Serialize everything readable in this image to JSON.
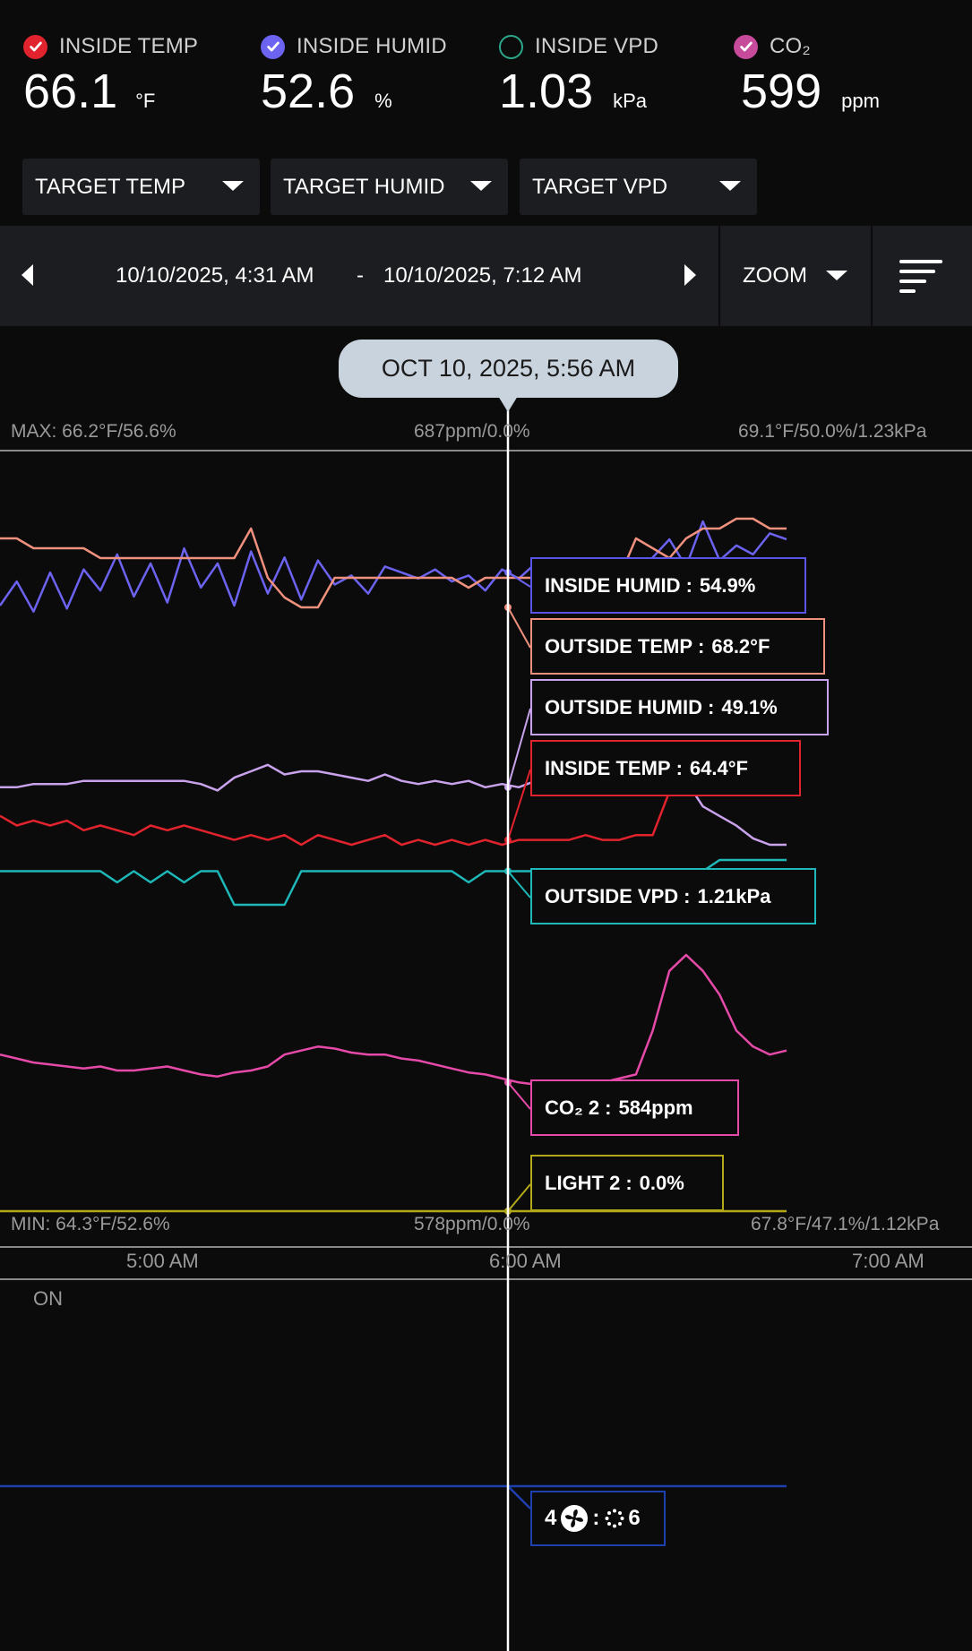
{
  "stats": [
    {
      "label": "INSIDE TEMP",
      "value": "66.1",
      "unit": "°F",
      "color": "#e0232d",
      "checked": true
    },
    {
      "label": "INSIDE HUMID",
      "value": "52.6",
      "unit": "%",
      "color": "#6c63f0",
      "checked": true
    },
    {
      "label": "INSIDE VPD",
      "value": "1.03",
      "unit": "kPa",
      "color": "#2ba88a",
      "checked": false
    },
    {
      "label": "CO₂",
      "value": "599",
      "unit": "ppm",
      "color": "#c74a9b",
      "checked": true
    }
  ],
  "targets": [
    "TARGET TEMP",
    "TARGET HUMID",
    "TARGET VPD"
  ],
  "range": {
    "start": "10/10/2025, 4:31 AM",
    "dash": "-",
    "end": "10/10/2025, 7:12 AM",
    "zoom": "ZOOM"
  },
  "cursor": {
    "label": "OCT 10, 2025, 5:56 AM"
  },
  "scale": {
    "max_left": "MAX: 66.2°F/56.6%",
    "max_center": "687ppm/0.0%",
    "max_right": "69.1°F/50.0%/1.23kPa",
    "min_left": "MIN: 64.3°F/52.6%",
    "min_center": "578ppm/0.0%",
    "min_right": "67.8°F/47.1%/1.12kPa"
  },
  "time_axis": [
    "5:00 AM",
    "6:00 AM",
    "7:00 AM"
  ],
  "device_lane": {
    "on_label": "ON",
    "tooltip_left": "4",
    "tooltip_sep": ":",
    "tooltip_right": "6"
  },
  "tooltips": [
    {
      "name": "INSIDE HUMID",
      "value": "54.9%",
      "color": "#5a55e6"
    },
    {
      "name": "OUTSIDE TEMP",
      "value": "68.2°F",
      "color": "#f0917e"
    },
    {
      "name": "OUTSIDE HUMID",
      "value": "49.1%",
      "color": "#c9a2ec"
    },
    {
      "name": "INSIDE TEMP",
      "value": "64.4°F",
      "color": "#e0232d"
    },
    {
      "name": "OUTSIDE VPD",
      "value": "1.21kPa",
      "color": "#1fb8b8"
    },
    {
      "name": "CO₂ 2",
      "value": "584ppm",
      "color": "#e64aa8"
    },
    {
      "name": "LIGHT 2",
      "value": "0.0%",
      "color": "#b3a81a"
    }
  ],
  "chart_data": {
    "type": "line",
    "x_range": [
      "4:31 AM",
      "7:12 AM"
    ],
    "x_ticks": [
      "5:00 AM",
      "6:00 AM",
      "7:00 AM"
    ],
    "cursor_time": "5:56 AM",
    "series": [
      {
        "name": "INSIDE HUMID",
        "color": "#6c63f0",
        "cursor_value": 54.9,
        "unit": "%",
        "y": [
          53.8,
          54.6,
          53.6,
          54.9,
          53.7,
          55.0,
          54.3,
          55.5,
          54.1,
          55.2,
          53.9,
          55.7,
          54.4,
          55.2,
          53.8,
          55.6,
          54.2,
          55.4,
          54.0,
          55.3,
          54.5,
          54.8,
          54.2,
          55.1,
          54.9,
          54.7,
          55.0,
          54.6,
          54.8,
          54.3,
          55.0,
          54.7,
          55.2,
          54.9,
          54.6,
          55.1,
          54.9,
          55.2,
          54.9,
          55.4,
          56.0,
          55.1,
          56.6,
          55.3,
          55.8,
          55.5,
          56.2,
          56.0
        ]
      },
      {
        "name": "OUTSIDE TEMP",
        "color": "#f0917e",
        "cursor_value": 68.2,
        "unit": "°F",
        "y": [
          68.9,
          68.9,
          68.8,
          68.8,
          68.8,
          68.8,
          68.7,
          68.7,
          68.7,
          68.7,
          68.7,
          68.7,
          68.7,
          68.7,
          68.7,
          69.0,
          68.5,
          68.3,
          68.2,
          68.2,
          68.5,
          68.5,
          68.5,
          68.5,
          68.5,
          68.5,
          68.5,
          68.5,
          68.4,
          68.5,
          68.5,
          68.5,
          68.5,
          68.5,
          68.5,
          68.4,
          68.5,
          68.5,
          68.9,
          68.8,
          68.7,
          68.9,
          69.0,
          69.0,
          69.1,
          69.1,
          69.0,
          69.0
        ]
      },
      {
        "name": "OUTSIDE HUMID",
        "color": "#c9a2ec",
        "cursor_value": 49.1,
        "unit": "%",
        "y": [
          49.1,
          49.1,
          49.2,
          49.2,
          49.2,
          49.3,
          49.3,
          49.3,
          49.3,
          49.3,
          49.3,
          49.3,
          49.2,
          49.0,
          49.4,
          49.6,
          49.8,
          49.5,
          49.6,
          49.6,
          49.5,
          49.4,
          49.3,
          49.5,
          49.3,
          49.2,
          49.3,
          49.2,
          49.3,
          49.1,
          49.2,
          49.1,
          49.3,
          49.1,
          49.5,
          49.3,
          49.6,
          49.8,
          50.2,
          50.3,
          50.1,
          49.3,
          48.5,
          48.2,
          47.9,
          47.5,
          47.3,
          47.3
        ]
      },
      {
        "name": "INSIDE TEMP",
        "color": "#e0232d",
        "cursor_value": 64.4,
        "unit": "°F",
        "y": [
          64.9,
          64.7,
          64.8,
          64.7,
          64.8,
          64.6,
          64.7,
          64.6,
          64.5,
          64.7,
          64.6,
          64.7,
          64.6,
          64.5,
          64.4,
          64.5,
          64.4,
          64.5,
          64.3,
          64.5,
          64.4,
          64.3,
          64.4,
          64.5,
          64.3,
          64.4,
          64.3,
          64.4,
          64.3,
          64.4,
          64.3,
          64.4,
          64.4,
          64.4,
          64.4,
          64.5,
          64.4,
          64.4,
          64.5,
          64.5,
          65.4,
          65.6,
          65.6,
          65.6,
          65.6,
          65.6,
          65.6,
          65.6
        ]
      },
      {
        "name": "OUTSIDE VPD",
        "color": "#1fb8b8",
        "cursor_value": 1.21,
        "unit": "kPa",
        "y": [
          1.21,
          1.21,
          1.21,
          1.21,
          1.21,
          1.21,
          1.21,
          1.2,
          1.21,
          1.2,
          1.21,
          1.2,
          1.21,
          1.21,
          1.18,
          1.18,
          1.18,
          1.18,
          1.21,
          1.21,
          1.21,
          1.21,
          1.21,
          1.21,
          1.21,
          1.21,
          1.21,
          1.21,
          1.2,
          1.21,
          1.21,
          1.21,
          1.21,
          1.21,
          1.21,
          1.21,
          1.21,
          1.21,
          1.21,
          1.21,
          1.21,
          1.21,
          1.21,
          1.22,
          1.22,
          1.22,
          1.22,
          1.22
        ]
      },
      {
        "name": "CO₂ 2",
        "color": "#e64aa8",
        "cursor_value": 584,
        "unit": "ppm",
        "y": [
          598,
          596,
          594,
          593,
          592,
          591,
          592,
          590,
          590,
          591,
          592,
          590,
          588,
          587,
          589,
          590,
          592,
          598,
          600,
          602,
          601,
          599,
          598,
          598,
          596,
          595,
          593,
          591,
          589,
          588,
          586,
          584,
          583,
          582,
          581,
          582,
          584,
          586,
          588,
          610,
          640,
          648,
          640,
          628,
          610,
          602,
          598,
          600
        ]
      },
      {
        "name": "LIGHT 2",
        "color": "#b3a81a",
        "cursor_value": 0.0,
        "unit": "%",
        "y": [
          0.0,
          0.0,
          0.0,
          0.0,
          0.0,
          0.0,
          0.0,
          0.0,
          0.0,
          0.0,
          0.0,
          0.0,
          0.0,
          0.0,
          0.0,
          0.0,
          0.0,
          0.0,
          0.0,
          0.0,
          0.0,
          0.0,
          0.0,
          0.0,
          0.0,
          0.0,
          0.0,
          0.0,
          0.0,
          0.0,
          0.0,
          0.0,
          0.0,
          0.0,
          0.0,
          0.0,
          0.0,
          0.0,
          0.0,
          0.0,
          0.0,
          0.0,
          0.0,
          0.0,
          0.0,
          0.0,
          0.0,
          0.0
        ]
      }
    ]
  }
}
